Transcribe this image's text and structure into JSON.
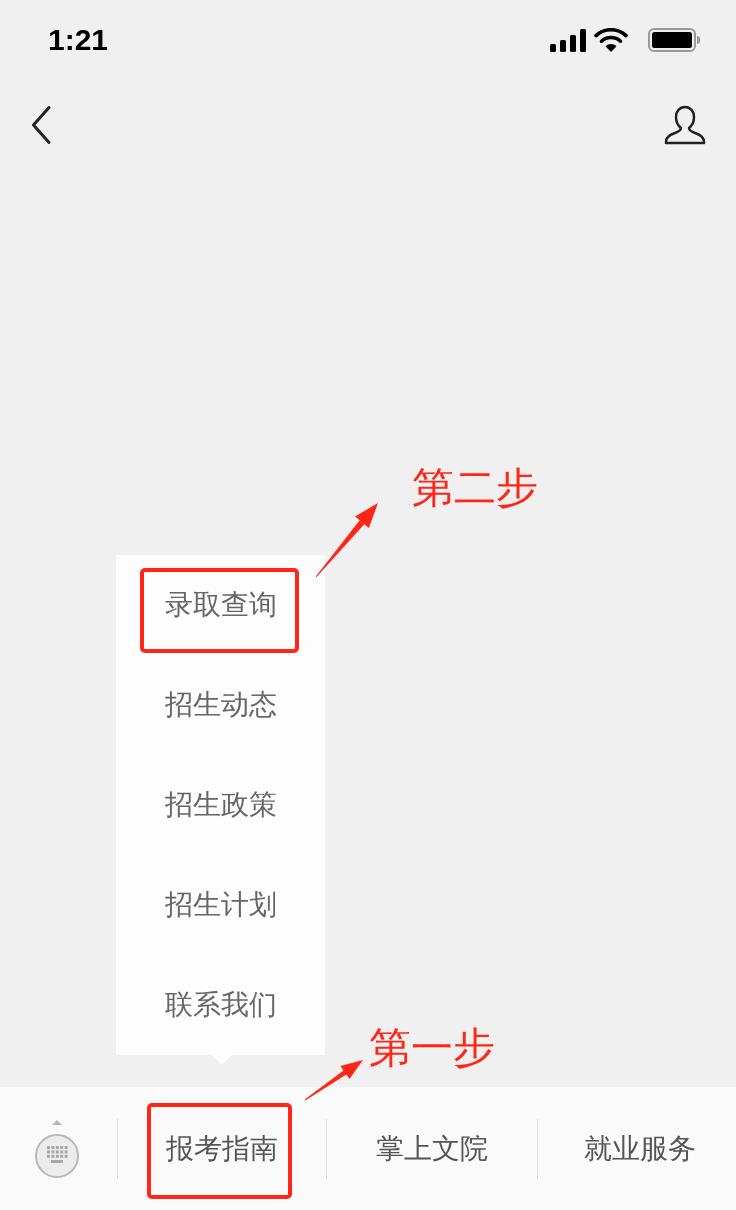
{
  "status_bar": {
    "time": "1:21"
  },
  "popup_menu": {
    "items": [
      {
        "label": "录取查询",
        "highlighted": true,
        "note": "第二步"
      },
      {
        "label": "招生动态",
        "highlighted": false
      },
      {
        "label": "招生政策",
        "highlighted": false
      },
      {
        "label": "招生计划",
        "highlighted": false
      },
      {
        "label": "联系我们",
        "highlighted": false
      }
    ]
  },
  "tab_bar": {
    "items": [
      {
        "label": "报考指南",
        "highlighted": true,
        "note": "第一步"
      },
      {
        "label": "掌上文院",
        "highlighted": false
      },
      {
        "label": "就业服务",
        "highlighted": false
      }
    ]
  }
}
